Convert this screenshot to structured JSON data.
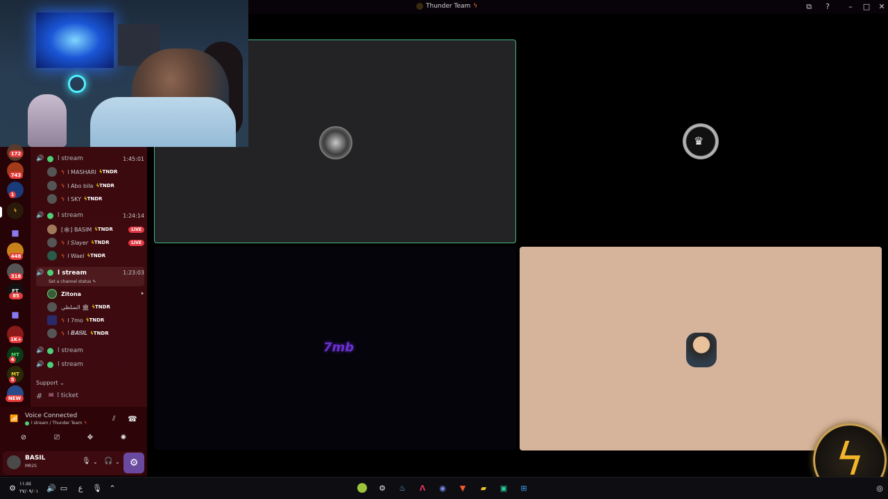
{
  "window": {
    "title": "Thunder Team",
    "title_icon": "bolt"
  },
  "servers": [
    {
      "badge": "172"
    },
    {
      "badge": "743"
    },
    {
      "badge": "1"
    },
    {
      "badge": ""
    },
    {
      "badge": ""
    },
    {
      "badge": "448"
    },
    {
      "badge": "318"
    },
    {
      "label": "FT",
      "badge": "85"
    },
    {
      "badge": ""
    },
    {
      "badge": "1K+"
    },
    {
      "label": "MT",
      "badge": "4"
    },
    {
      "label": "MT",
      "badge": "5"
    },
    {
      "badge": "NEW"
    }
  ],
  "voice_channels": [
    {
      "name": "l stream",
      "time": "1:45:01",
      "members": [
        {
          "name": "l MASHARI",
          "tag": "TNDR"
        },
        {
          "name": "l Abo bila",
          "tag": "TNDR"
        },
        {
          "name": "l SKY",
          "tag": "TNDR"
        }
      ]
    },
    {
      "name": "l stream",
      "time": "1:24:14",
      "members": [
        {
          "name": "[🕸] BASIM",
          "tag": "TNDR",
          "live": "LIVE"
        },
        {
          "name": "l Slayer",
          "tag": "TNDR",
          "live": "LIVE"
        },
        {
          "name": "l Wael",
          "tag": "TNDR"
        }
      ]
    },
    {
      "name": "l stream",
      "time": "1:23:03",
      "status": "Set a channel status",
      "members": [
        {
          "name": "Zitona",
          "tag": ""
        },
        {
          "name": "السلطي 🏛",
          "tag": "TNDR"
        },
        {
          "name": "l 7mo",
          "tag": "TNDR"
        },
        {
          "name": "l 𝑩𝑨𝑺𝑰𝑳",
          "tag": "TNDR"
        }
      ]
    },
    {
      "name": "l stream"
    },
    {
      "name": "l stream"
    }
  ],
  "category": "Support",
  "text_channel": "l ticket",
  "voice_panel": {
    "status": "Voice Connected",
    "location": "l stream / Thunder Team"
  },
  "user": {
    "name": "BASIL",
    "status": "MR2S"
  },
  "tiles": [
    {
      "bg": "#232325",
      "label": ""
    },
    {
      "bg": "#000000",
      "label": ""
    },
    {
      "bg": "#05040a",
      "label": "7mb"
    },
    {
      "bg": "#d6b39b",
      "label": ""
    }
  ],
  "taskbar": {
    "time": "١١:٥٤",
    "date": "٢٧/٠٩/٠١",
    "lang": "ع"
  },
  "colors": {
    "speaking_border": "#43b581",
    "online": "#4ed07a",
    "live": "#e33b45",
    "accent": "#f3b52a"
  }
}
